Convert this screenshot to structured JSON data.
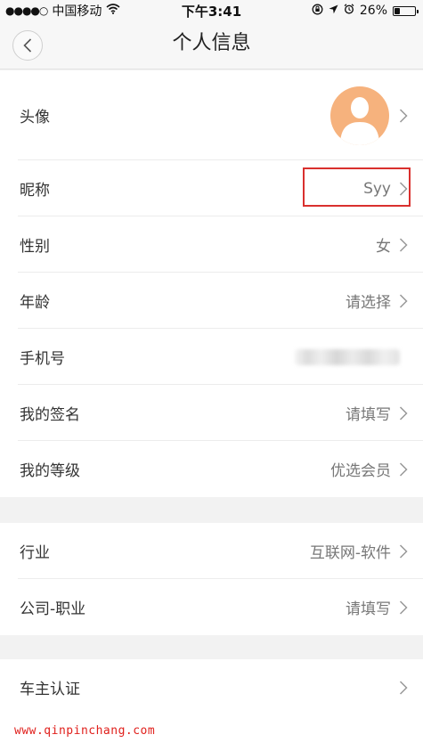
{
  "status_bar": {
    "signal_dots": "●●●●○",
    "carrier": "中国移动",
    "time": "下午3:41",
    "battery": "26%",
    "battery_level": 0.26
  },
  "nav": {
    "title": "个人信息",
    "back_icon": "chevron-left-icon"
  },
  "profile": {
    "avatar_label": "头像",
    "nickname_label": "昵称",
    "nickname_value": "Syy",
    "gender_label": "性别",
    "gender_value": "女",
    "age_label": "年龄",
    "age_value": "请选择",
    "phone_label": "手机号",
    "signature_label": "我的签名",
    "signature_value": "请填写",
    "level_label": "我的等级",
    "level_value": "优选会员"
  },
  "work": {
    "industry_label": "行业",
    "industry_value": "互联网-软件",
    "company_label": "公司-职业",
    "company_value": "请填写"
  },
  "car": {
    "owner_label": "车主认证"
  },
  "watermark": "www.qinpinchang.com",
  "colors": {
    "highlight": "#d9302e",
    "avatar_bg": "#f6b27d",
    "watermark": "#e0201c"
  }
}
